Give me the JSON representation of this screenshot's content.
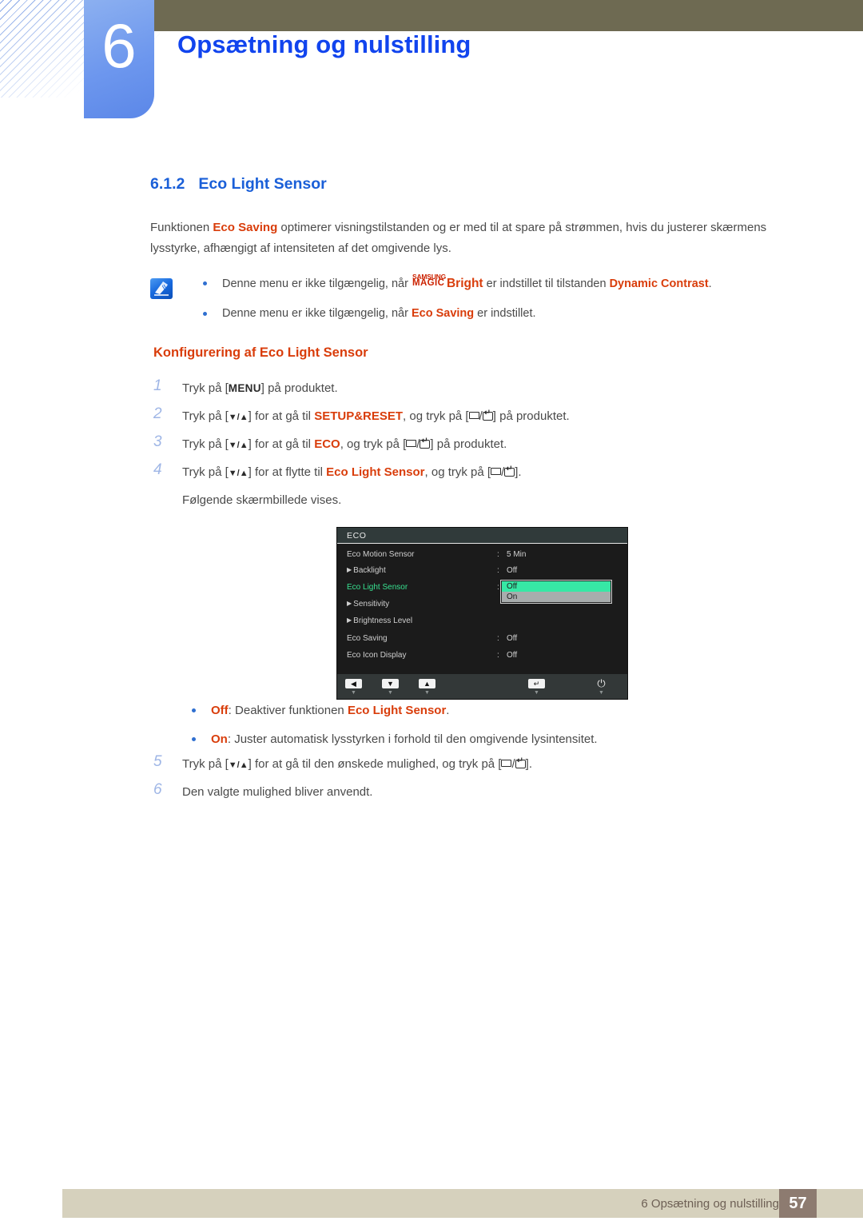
{
  "header": {
    "chapter_number": "6",
    "chapter_title": "Opsætning og nulstilling"
  },
  "section": {
    "number": "6.1.2",
    "title": "Eco Light Sensor",
    "intro_before": "Funktionen ",
    "intro_kw": "Eco Saving",
    "intro_after": " optimerer visningstilstanden og er med til at spare på strømmen, hvis du justerer skærmens lysstyrke, afhængigt af intensiteten af det omgivende lys."
  },
  "note": {
    "icon": "note-pen-icon",
    "bullets": [
      {
        "pre": "Denne menu er ikke tilgængelig, når ",
        "magic_top": "SAMSUNG",
        "magic_bottom": "MAGIC",
        "magic_word": "Bright",
        "mid": " er indstillet til tilstanden ",
        "kw": "Dynamic Contrast",
        "post": "."
      },
      {
        "pre": "Denne menu er ikke tilgængelig, når ",
        "kw": "Eco Saving",
        "post": " er indstillet."
      }
    ]
  },
  "procedure": {
    "heading": "Konfigurering af Eco Light Sensor",
    "steps": [
      {
        "n": "1",
        "a": "Tryk på [",
        "key": "MENU",
        "b": "] på produktet."
      },
      {
        "n": "2",
        "a": "Tryk på [",
        "arrows": "▼/▲",
        "b": "] for at gå til ",
        "kw": "SETUP&RESET",
        "c": ", og tryk på [",
        "d": "] på produktet."
      },
      {
        "n": "3",
        "a": "Tryk på [",
        "arrows": "▼/▲",
        "b": "] for at gå til ",
        "kw": "ECO",
        "c": ", og tryk på [",
        "d": "] på produktet."
      },
      {
        "n": "4",
        "a": "Tryk på [",
        "arrows": "▼/▲",
        "b": "] for at flytte til ",
        "kw": "Eco Light Sensor",
        "c": ", og tryk på [",
        "d": "].",
        "sub": "Følgende skærmbillede vises."
      }
    ],
    "steps_after": [
      {
        "n": "5",
        "a": "Tryk på [",
        "arrows": "▼/▲",
        "b": "] for at gå til den ønskede mulighed, og tryk på [",
        "d": "]."
      },
      {
        "n": "6",
        "a": "Den valgte mulighed bliver anvendt."
      }
    ]
  },
  "osd": {
    "title": "ECO",
    "rows": [
      {
        "label": "Eco Motion Sensor",
        "caret": false,
        "selected": false,
        "colon": ":",
        "value": "5 Min"
      },
      {
        "label": "Backlight",
        "caret": true,
        "selected": false,
        "colon": ":",
        "value": "Off"
      },
      {
        "label": "Eco Light Sensor",
        "caret": false,
        "selected": true,
        "colon": ":",
        "value": ""
      },
      {
        "label": "Sensitivity",
        "caret": true,
        "selected": false,
        "colon": "",
        "value": ""
      },
      {
        "label": "Brightness Level",
        "caret": true,
        "selected": false,
        "colon": "",
        "value": ""
      },
      {
        "label": "Eco Saving",
        "caret": false,
        "selected": false,
        "colon": ":",
        "value": "Off"
      },
      {
        "label": "Eco Icon Display",
        "caret": false,
        "selected": false,
        "colon": ":",
        "value": "Off"
      }
    ],
    "dropdown": {
      "highlighted": "Off",
      "other": "On"
    },
    "footer_buttons": [
      {
        "name": "left-arrow",
        "glyph": "◀"
      },
      {
        "name": "down-arrow",
        "glyph": "▼"
      },
      {
        "name": "up-arrow",
        "glyph": "▲"
      },
      {
        "name": "enter",
        "glyph": "↵"
      },
      {
        "name": "power",
        "glyph": "⏻"
      }
    ],
    "colors": {
      "background": "#1b1b1b",
      "title_bar": "#303a3a",
      "selected_text": "#37e08f",
      "option_highlight": "#37e8a5",
      "option_other": "#a8adad",
      "footer_bar": "#333838"
    }
  },
  "options": [
    {
      "kw": "Off",
      "text": "Deaktiver funktionen ",
      "kw2": "Eco Light Sensor",
      "post": "."
    },
    {
      "kw": "On",
      "text": "Juster automatisk lysstyrken i forhold til den omgivende lysintensitet.",
      "kw2": "",
      "post": ""
    }
  ],
  "footer": {
    "text": "6 Opsætning og nulstilling",
    "page": "57"
  },
  "theme": {
    "accent_blue": "#1144ee",
    "heading_blue": "#1a5fd8",
    "keyword_red": "#d93d0b",
    "olive": "#6e6a52",
    "footer_bg": "#d6d1bd",
    "footer_page_bg": "#8d7b70"
  }
}
